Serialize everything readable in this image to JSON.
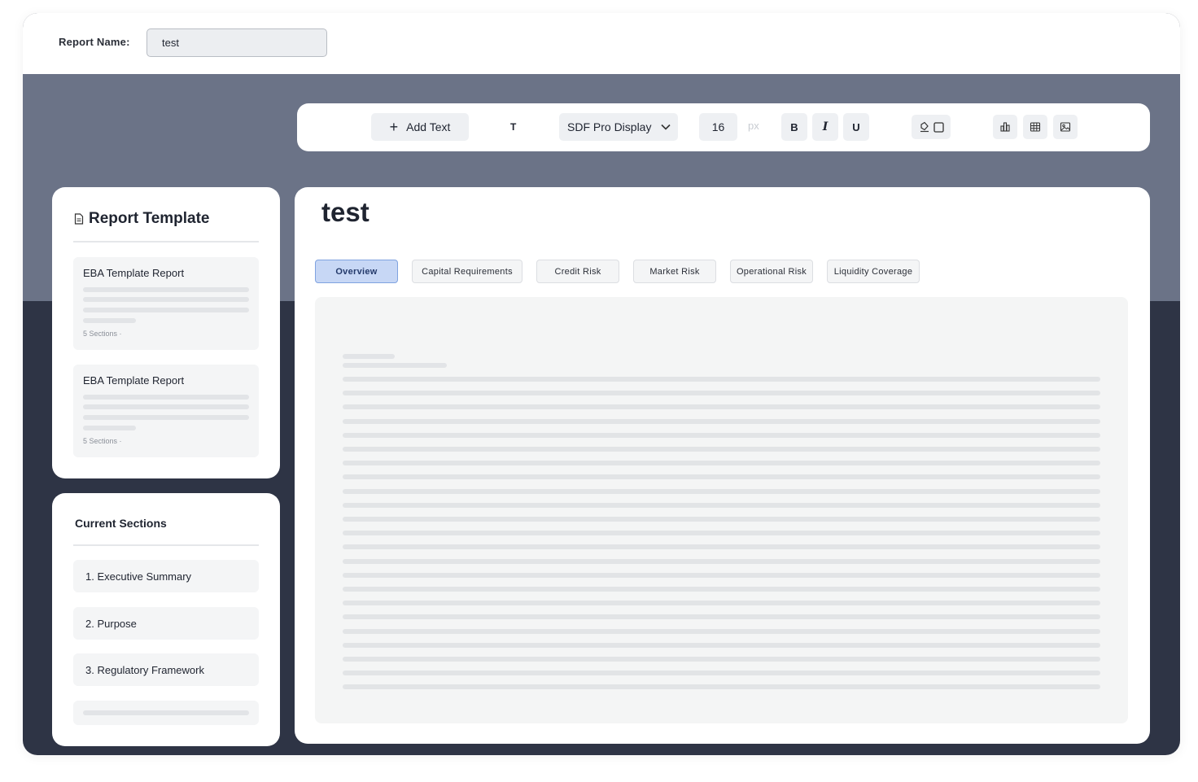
{
  "report": {
    "name_label": "Report Name:",
    "name_value": "test"
  },
  "toolbar": {
    "add_text_label": "Add Text",
    "text_tool_label": "T",
    "font_family": "SDF Pro Display",
    "font_size": "16",
    "font_size_unit": "px",
    "bold_label": "B",
    "italic_label": "I",
    "underline_label": "U"
  },
  "template_panel": {
    "title": "Report Template",
    "templates": [
      {
        "name": "EBA Template Report",
        "meta": "5 Sections  ·"
      },
      {
        "name": "EBA Template Report",
        "meta": "5 Sections  ·"
      }
    ]
  },
  "sections_panel": {
    "title": "Current Sections",
    "items": [
      {
        "number": "1.",
        "label": "Executive Summary"
      },
      {
        "number": "2.",
        "label": "Purpose"
      },
      {
        "number": "3.",
        "label": "Regulatory Framework"
      }
    ]
  },
  "document": {
    "title": "test",
    "tabs": [
      {
        "label": "Overview",
        "active": true
      },
      {
        "label": "Capital Requirements",
        "active": false
      },
      {
        "label": "Credit Risk",
        "active": false
      },
      {
        "label": "Market Risk",
        "active": false
      },
      {
        "label": "Operational Risk",
        "active": false
      },
      {
        "label": "Liquidity Coverage",
        "active": false
      }
    ]
  },
  "icons": {
    "add": "plus-icon",
    "dropdown": "chevron-down-icon",
    "fill": "paint-bucket-icon",
    "border": "square-outline-icon",
    "chart": "bar-chart-icon",
    "table": "table-icon",
    "image": "image-icon",
    "template": "document-icon"
  },
  "colors": {
    "band": "#6b7387",
    "background_dark": "#2e3445",
    "active_tab": "#c7d7f5"
  }
}
